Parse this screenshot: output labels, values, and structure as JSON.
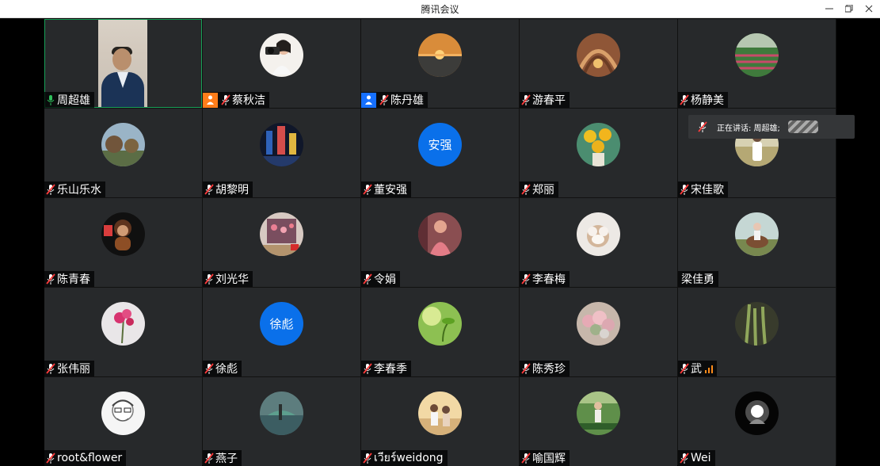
{
  "window": {
    "title": "腾讯会议"
  },
  "tooltip": {
    "text": "正在讲话: 周超雄;"
  },
  "participants": [
    {
      "name": "周超雄",
      "type": "video",
      "active": true,
      "mic_state": "on"
    },
    {
      "name": "蔡秋洁",
      "avatar": "woman-with-camera",
      "badge": "host",
      "mic_state": "muted"
    },
    {
      "name": "陈丹雄",
      "avatar": "sunset-sea",
      "badge": "cohost",
      "mic_state": "muted"
    },
    {
      "name": "游春平",
      "avatar": "wood-tunnel",
      "mic_state": "muted"
    },
    {
      "name": "杨静美",
      "avatar": "garden-rows",
      "mic_state": "muted"
    },
    {
      "name": "乐山乐水",
      "avatar": "landscape-trees",
      "mic_state": "muted"
    },
    {
      "name": "胡黎明",
      "avatar": "city-night",
      "mic_state": "muted"
    },
    {
      "name": "董安强",
      "avatar_text": "安强",
      "mic_state": "muted"
    },
    {
      "name": "郑丽",
      "avatar": "sunflowers",
      "mic_state": "muted"
    },
    {
      "name": "宋佳歌",
      "avatar": "girl-in-field",
      "mic_state": "muted"
    },
    {
      "name": "陈青春",
      "avatar": "monkey-toy",
      "mic_state": "muted"
    },
    {
      "name": "刘光华",
      "avatar": "cabinet-flowers",
      "mic_state": "muted"
    },
    {
      "name": "令娟",
      "avatar": "painting-lady",
      "mic_state": "muted"
    },
    {
      "name": "李春梅",
      "avatar": "dog",
      "mic_state": "muted"
    },
    {
      "name": "梁佳勇",
      "avatar": "horse-rider",
      "mic_state": "none"
    },
    {
      "name": "张伟丽",
      "avatar": "pink-flower",
      "mic_state": "muted"
    },
    {
      "name": "徐彪",
      "avatar_text": "徐彪",
      "mic_state": "muted"
    },
    {
      "name": "李春季",
      "avatar": "green-sprout",
      "mic_state": "muted"
    },
    {
      "name": "陈秀珍",
      "avatar": "flower-basket",
      "mic_state": "muted"
    },
    {
      "name": "武",
      "avatar": "grass-dark",
      "mic_state": "muted",
      "signal": true
    },
    {
      "name": "root&flower",
      "avatar": "sketch-man",
      "mic_state": "muted"
    },
    {
      "name": "燕子",
      "avatar": "lake-reflection",
      "mic_state": "muted"
    },
    {
      "name": "เวียร์weidong",
      "avatar": "girls-at-sea",
      "mic_state": "muted"
    },
    {
      "name": "喻国辉",
      "avatar": "farm-person",
      "mic_state": "muted"
    },
    {
      "name": "Wei",
      "avatar": "light-in-hand",
      "mic_state": "muted"
    }
  ]
}
